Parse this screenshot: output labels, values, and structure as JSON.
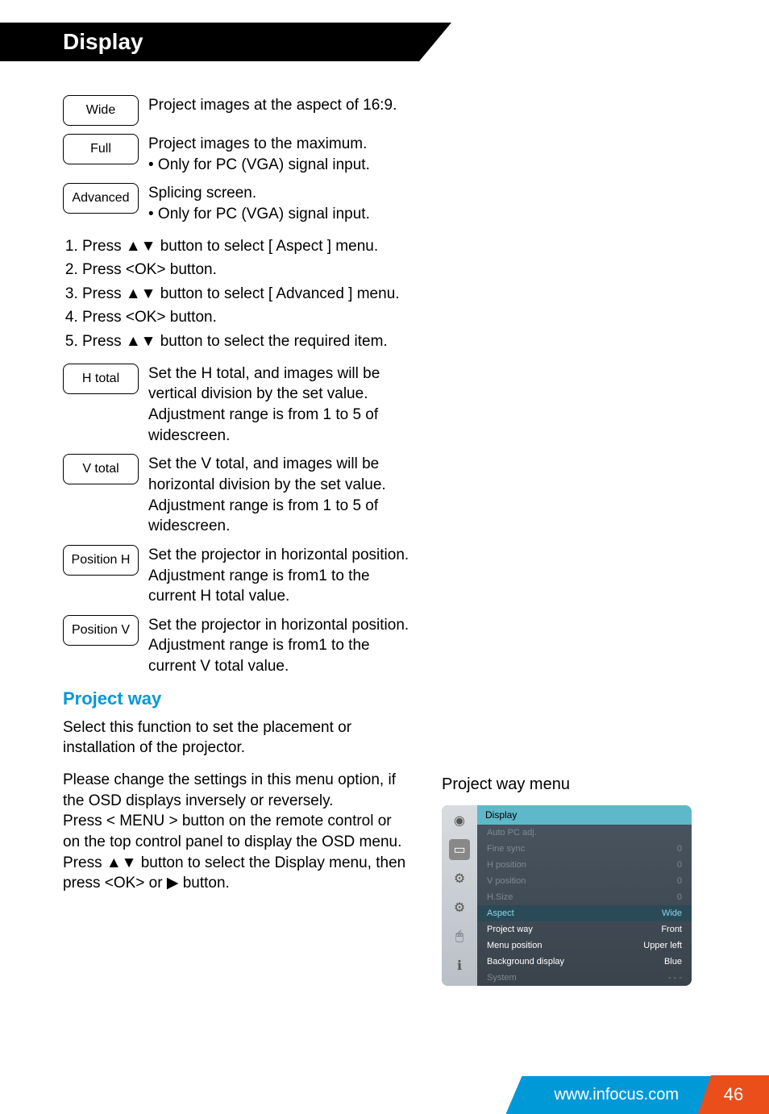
{
  "header": {
    "title": "Display"
  },
  "aspect_options": [
    {
      "label": "Wide",
      "desc": "Project images at the aspect of 16:9."
    },
    {
      "label": "Full",
      "desc": "Project images to the maximum.\n•  Only for PC (VGA) signal input."
    },
    {
      "label": "Advanced",
      "desc": "Splicing screen.\n•  Only for PC (VGA) signal input."
    }
  ],
  "steps": [
    "Press ▲▼ button to select [ Aspect ] menu.",
    "Press <OK> button.",
    "Press ▲▼ button to select [ Advanced ] menu.",
    "Press <OK> button.",
    "Press ▲▼ button to select the required item."
  ],
  "advanced_items": [
    {
      "label": "H total",
      "desc": "Set the H total, and images will be vertical division by the set value.\nAdjustment range is from 1 to 5 of widescreen."
    },
    {
      "label": "V total",
      "desc": "Set the V total, and images will be horizontal division by the set value.\nAdjustment range is from 1 to 5 of widescreen."
    },
    {
      "label": "Position H",
      "desc": "Set the projector in horizontal position.\nAdjustment range is from1 to the current H total value."
    },
    {
      "label": "Position V",
      "desc": "Set the projector in horizontal position.\nAdjustment range is from1 to the current V total value."
    }
  ],
  "project_way": {
    "title": "Project way",
    "p1": "Select this function to set the placement or installation of the projector.",
    "p2": "Please change the settings in this menu option, if the OSD displays inversely or reversely.\nPress < MENU > button on the remote control or on the top control panel to display the OSD menu. Press ▲▼ button to select the Display menu, then press <OK> or ▶ button."
  },
  "menu_panel": {
    "title": "Project way menu",
    "head": "Display",
    "items": [
      {
        "name": "Auto PC adj.",
        "value": "",
        "class": "dim"
      },
      {
        "name": "Fine sync",
        "value": "0",
        "class": "dim"
      },
      {
        "name": "H position",
        "value": "0",
        "class": "dim"
      },
      {
        "name": "V position",
        "value": "0",
        "class": "dim"
      },
      {
        "name": "H.Size",
        "value": "0",
        "class": "dim"
      },
      {
        "name": "Aspect",
        "value": "Wide",
        "class": "sel"
      },
      {
        "name": "Project way",
        "value": "Front",
        "class": "active"
      },
      {
        "name": "Menu position",
        "value": "Upper left",
        "class": "active"
      },
      {
        "name": "Background display",
        "value": "Blue",
        "class": "active"
      },
      {
        "name": "System",
        "value": "- - -",
        "class": "dim"
      }
    ]
  },
  "footer": {
    "url": "www.infocus.com",
    "page": "46"
  }
}
